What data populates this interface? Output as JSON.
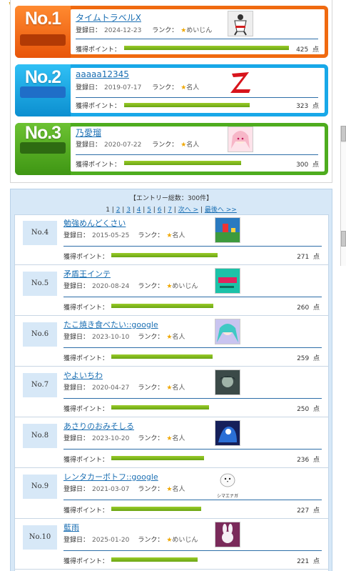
{
  "top": [
    {
      "no": "No.1",
      "name": "タイムトラベルX",
      "reg_label": "登録日：",
      "date": "2024-12-23",
      "rank_label": "ランク：",
      "rank": "めいじん",
      "points_label": "獲得ポイント：",
      "points": "425",
      "unit": "点",
      "fill": 1.0,
      "color": "#f06a10",
      "bar_color": "#b23a05",
      "thumb": "karate-icon"
    },
    {
      "no": "No.2",
      "name": "aaaaa12345",
      "reg_label": "登録日：",
      "date": "2019-07-17",
      "rank_label": "ランク：",
      "rank": "名人",
      "points_label": "獲得ポイント：",
      "points": "323",
      "unit": "点",
      "fill": 0.76,
      "color": "#18a8e8",
      "bar_color": "#1f6ec8",
      "thumb": "z-icon"
    },
    {
      "no": "No.3",
      "name": "乃愛瑠",
      "reg_label": "登録日：",
      "date": "2020-07-22",
      "rank_label": "ランク：",
      "rank": "名人",
      "points_label": "獲得ポイント：",
      "points": "300",
      "unit": "点",
      "fill": 0.71,
      "color": "#4eac1e",
      "bar_color": "#2e6b12",
      "thumb": "anime-girl-icon"
    }
  ],
  "list": {
    "entry_count": "【エントリー総数：300件】",
    "pager": [
      "1",
      "2",
      "3",
      "4",
      "5",
      "6",
      "7"
    ],
    "pager_next": "次へ >",
    "pager_last": "最後へ >>",
    "rows": [
      {
        "no": "No.4",
        "name": "勉強めんどくさい",
        "date": "2015-05-25",
        "rank": "名人",
        "points": "271",
        "fill": 0.66,
        "thumb": "game-screen-icon"
      },
      {
        "no": "No.5",
        "name": "矛盾王インテ",
        "date": "2020-08-24",
        "rank": "めいじん",
        "points": "260",
        "fill": 0.63,
        "thumb": "text-image-icon"
      },
      {
        "no": "No.6",
        "name": "たこ焼き食べたい::google",
        "date": "2023-10-10",
        "rank": "名人",
        "points": "259",
        "fill": 0.63,
        "thumb": "miku-icon"
      },
      {
        "no": "No.7",
        "name": "やよいちわ",
        "date": "2020-04-27",
        "rank": "名人",
        "points": "250",
        "fill": 0.61,
        "thumb": "portrait-icon"
      },
      {
        "no": "No.8",
        "name": "あさりのおみそしる",
        "date": "2023-10-20",
        "rank": "名人",
        "points": "236",
        "fill": 0.58,
        "thumb": "blue-character-icon"
      },
      {
        "no": "No.9",
        "name": "レンタカーボトフ::google",
        "date": "2021-03-07",
        "rank": "名人",
        "points": "227",
        "fill": 0.56,
        "thumb": "bird-icon"
      },
      {
        "no": "No.10",
        "name": "藍雨",
        "date": "2025-01-20",
        "rank": "めいじん",
        "points": "221",
        "fill": 0.54,
        "thumb": "rabbit-icon"
      }
    ],
    "reg_label": "登録日：",
    "rank_label": "ランク：",
    "points_label": "獲得ポイント：",
    "unit": "点",
    "thumb_caption_9": "シマエナガ"
  }
}
